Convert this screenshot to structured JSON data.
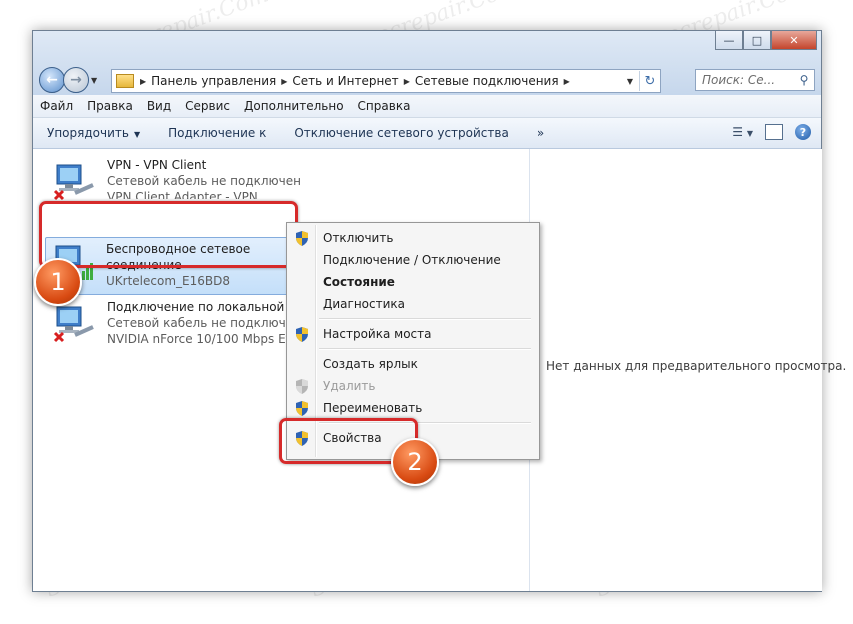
{
  "address": {
    "crumbs": [
      "Панель управления",
      "Сеть и Интернет",
      "Сетевые подключения"
    ]
  },
  "search": {
    "placeholder": "Поиск: Се..."
  },
  "menu": [
    "Файл",
    "Правка",
    "Вид",
    "Сервис",
    "Дополнительно",
    "Справка"
  ],
  "toolbar": {
    "organize": "Упорядочить",
    "connect": "Подключение к",
    "disable": "Отключение сетевого устройства",
    "more": "»"
  },
  "connections": [
    {
      "name": "VPN - VPN Client",
      "status": "Сетевой кабель не подключен",
      "device": "VPN Client Adapter - VPN"
    },
    {
      "name_line1": "Беспроводное сетевое",
      "name_line2": "соединение",
      "network": "UKrtelecom_E16BD8"
    },
    {
      "name": "Подключение по локальной сети",
      "status": "Сетевой кабель не подключен",
      "device": "NVIDIA nForce 10/100 Mbps Ether..."
    }
  ],
  "context_menu": {
    "items": [
      {
        "label": "Отключить",
        "icon": "uac-shield-icon"
      },
      {
        "label": "Подключение / Отключение"
      },
      {
        "label": "Состояние",
        "bold": true
      },
      {
        "label": "Диагностика"
      },
      {
        "label": "Настройка моста",
        "icon": "uac-shield-icon"
      },
      {
        "label": "Создать ярлык"
      },
      {
        "label": "Удалить",
        "icon": "uac-shield-icon",
        "disabled": true
      },
      {
        "label": "Переименовать",
        "icon": "uac-shield-icon"
      },
      {
        "label": "Свойства",
        "icon": "uac-shield-icon"
      }
    ]
  },
  "preview": {
    "text": "Нет данных для предварительного просмотра."
  },
  "markers": {
    "step1": "1",
    "step2": "2"
  },
  "watermark": "Soringpcrepair.Com",
  "colors": {
    "highlight": "#d62a2a",
    "marker": "#e05a1c",
    "selection": "#c4dff9"
  }
}
